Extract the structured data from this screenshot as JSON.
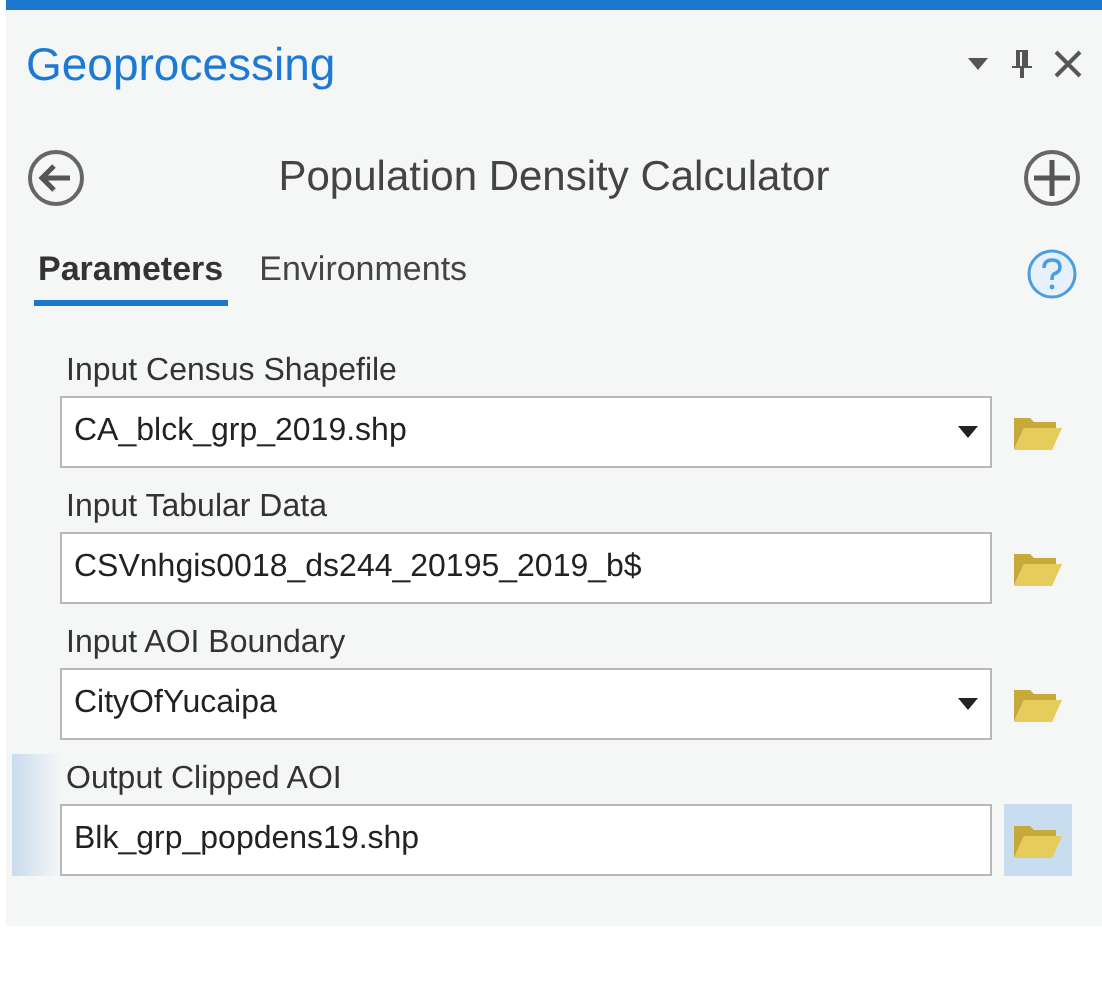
{
  "pane": {
    "title": "Geoprocessing"
  },
  "tool": {
    "title": "Population Density Calculator"
  },
  "tabs": [
    {
      "label": "Parameters",
      "selected": true
    },
    {
      "label": "Environments",
      "selected": false
    }
  ],
  "parameters": [
    {
      "label": "Input Census Shapefile",
      "value": "CA_blck_grp_2019.shp",
      "kind": "dropdown",
      "active": false
    },
    {
      "label": "Input Tabular Data",
      "value": "CSVnhgis0018_ds244_20195_2019_b$",
      "kind": "text",
      "active": false
    },
    {
      "label": "Input AOI Boundary",
      "value": "CityOfYucaipa",
      "kind": "dropdown",
      "active": false
    },
    {
      "label": "Output Clipped AOI",
      "value": "Blk_grp_popdens19.shp",
      "kind": "text",
      "active": true
    }
  ]
}
